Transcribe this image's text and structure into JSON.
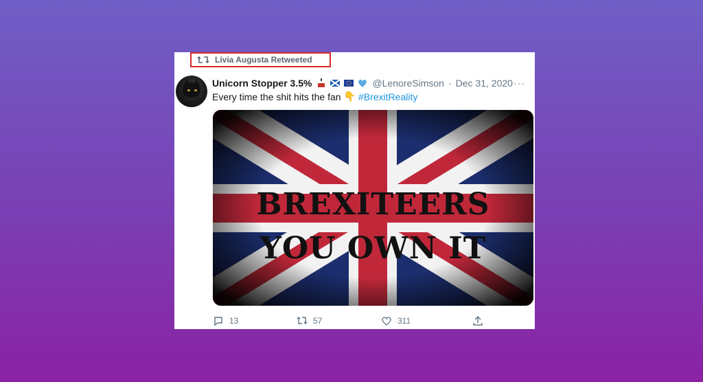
{
  "retweet": {
    "label": "Livia Augusta Retweeted"
  },
  "tweet": {
    "display_name": "Unicorn Stopper 3.5%",
    "handle": "@LenoreSimson",
    "separator": "·",
    "date": "Dec 31, 2020",
    "text_prefix": "Every time the shit hits the fan",
    "hashtag": "#BrexitReality",
    "more": "···",
    "emojis": [
      "unicorn-flag-icon",
      "scotland-flag-icon",
      "eu-flag-icon",
      "blue-heart-icon"
    ],
    "pointing_down_emoji": "👇"
  },
  "media": {
    "line1": "BREXITEERS",
    "line2": "YOU OWN IT"
  },
  "actions": {
    "replies": "13",
    "retweets": "57",
    "likes": "311"
  },
  "colors": {
    "accent": "#1b95e0",
    "highlight_border": "#d62b2b",
    "muted": "#657786"
  }
}
